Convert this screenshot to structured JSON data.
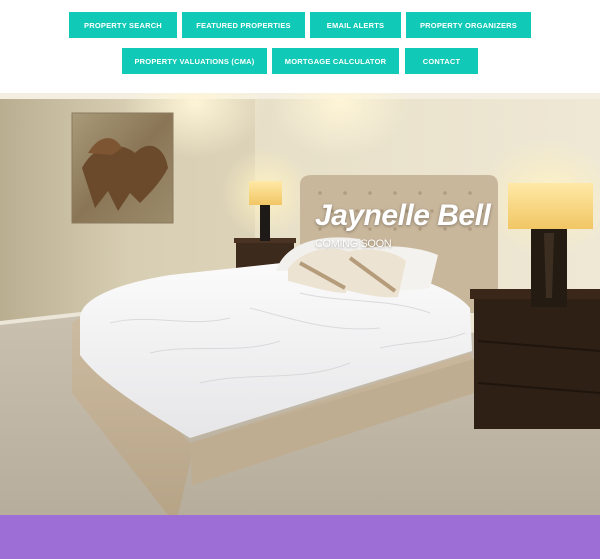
{
  "nav": {
    "items": [
      {
        "label": "PROPERTY SEARCH"
      },
      {
        "label": "FEATURED PROPERTIES"
      },
      {
        "label": "EMAIL ALERTS"
      },
      {
        "label": "PROPERTY ORGANIZERS"
      },
      {
        "label": "PROPERTY VALUATIONS (CMA)"
      },
      {
        "label": "MORTGAGE CALCULATOR"
      },
      {
        "label": "CONTACT"
      }
    ],
    "color": "#10c9b6"
  },
  "hero": {
    "title": "Jaynelle Bell",
    "subtitle": "COMING SOON"
  },
  "footer": {
    "color": "#9d6fd6"
  }
}
